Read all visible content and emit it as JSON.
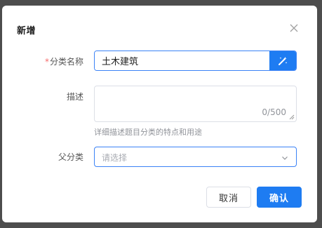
{
  "dialog": {
    "title": "新增",
    "close_icon": "close-icon"
  },
  "form": {
    "name": {
      "required_mark": "*",
      "label": "分类名称",
      "value": "土木建筑",
      "ai_button_icon": "magic-wand-icon"
    },
    "description": {
      "label": "描述",
      "value": "",
      "counter": "0/500",
      "help": "详细描述题目分类的特点和用途"
    },
    "parent": {
      "label": "父分类",
      "placeholder": "请选择",
      "chevron_icon": "chevron-down-icon"
    }
  },
  "footer": {
    "cancel_label": "取消",
    "confirm_label": "确认"
  },
  "colors": {
    "primary": "#1e7cf2",
    "required": "#f56c6c"
  }
}
